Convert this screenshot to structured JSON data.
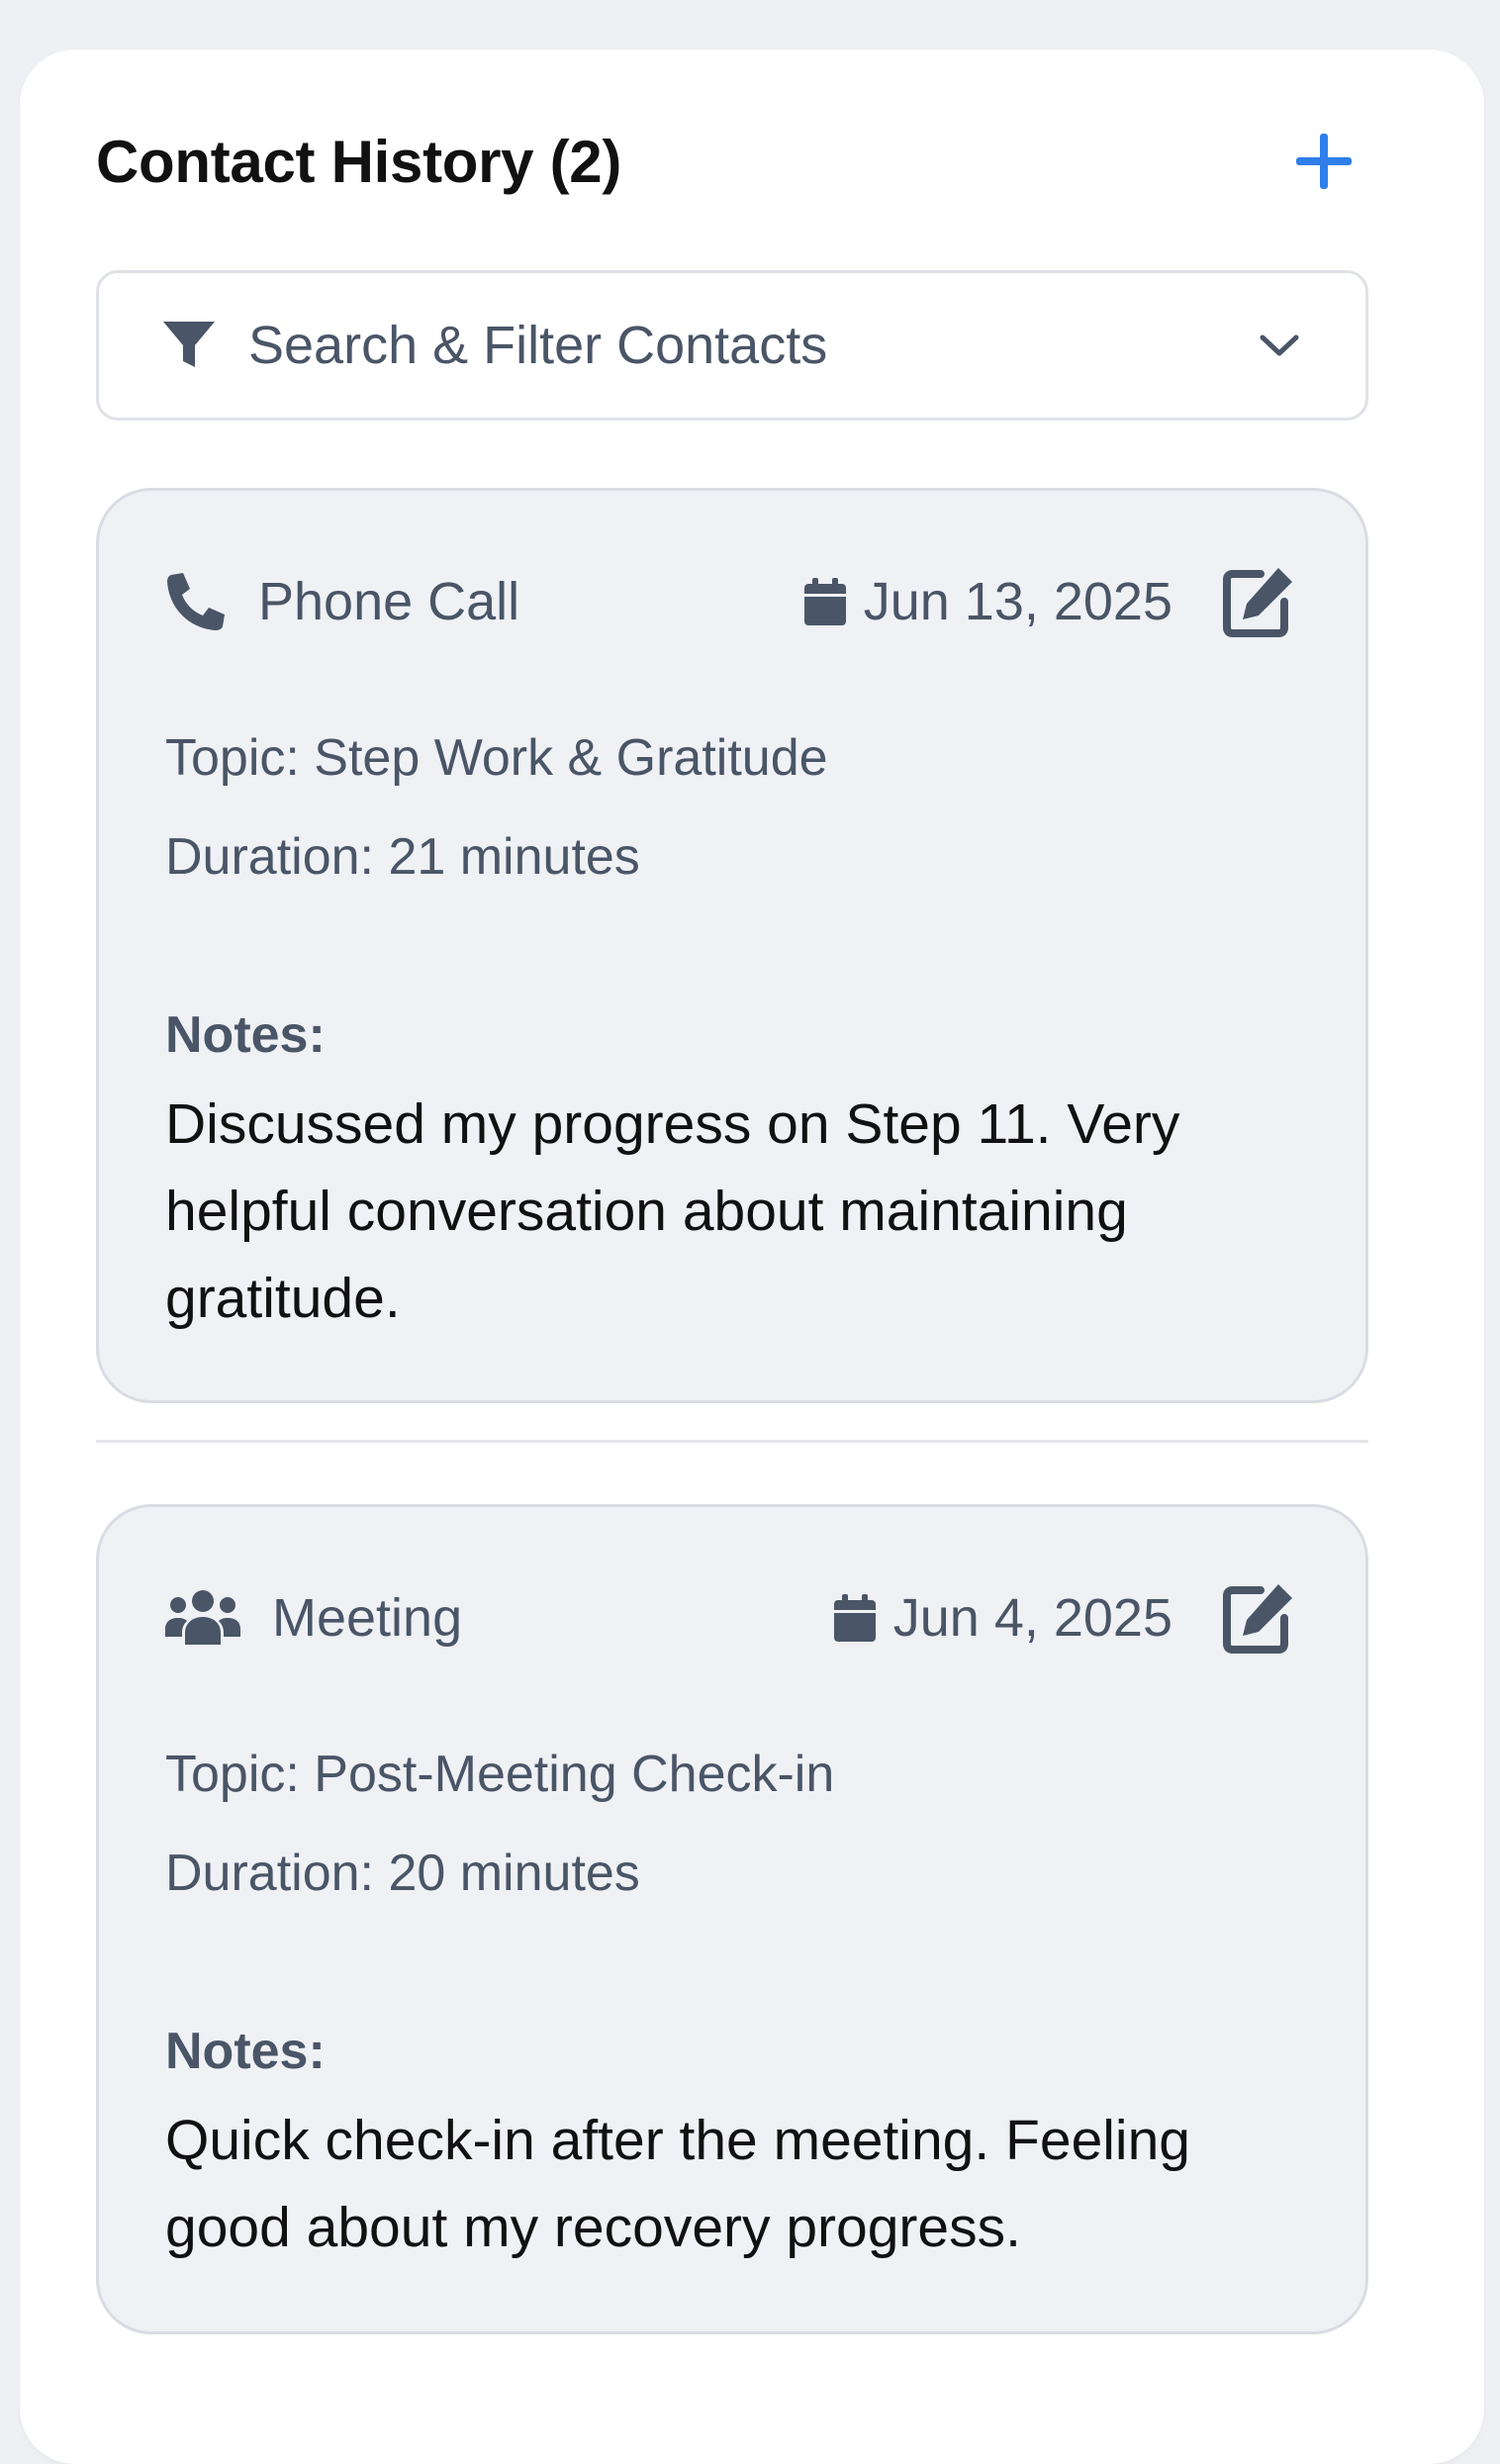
{
  "header": {
    "title": "Contact History (2)",
    "add_icon": "plus-icon",
    "accent_color": "#2f7ee9"
  },
  "filter": {
    "label": "Search & Filter Contacts",
    "icon": "funnel-icon",
    "toggle_icon": "chevron-down-icon"
  },
  "contacts": [
    {
      "type": "Phone Call",
      "type_icon": "phone-icon",
      "date": "Jun 13, 2025",
      "topic": "Topic: Step Work & Gratitude",
      "duration": "Duration: 21 minutes",
      "notes_label": "Notes:",
      "notes": "Discussed my progress on Step 11. Very helpful conversation about maintaining gratitude."
    },
    {
      "type": "Meeting",
      "type_icon": "users-icon",
      "date": "Jun 4, 2025",
      "topic": "Topic: Post-Meeting Check-in",
      "duration": "Duration: 20 minutes",
      "notes_label": "Notes:",
      "notes": "Quick check-in after the meeting. Feeling good about my recovery progress."
    }
  ]
}
